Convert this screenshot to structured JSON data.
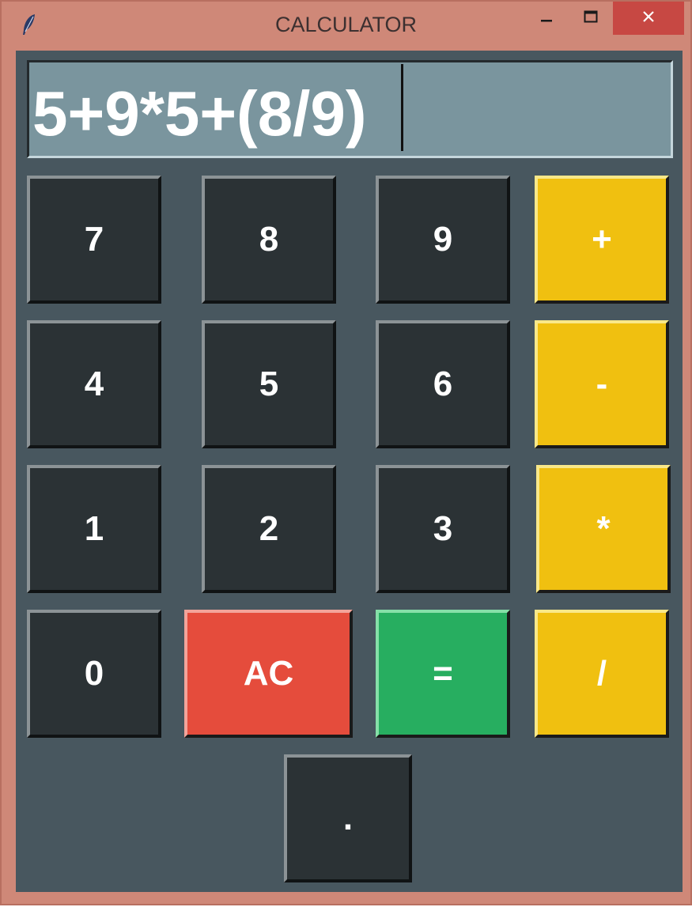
{
  "window": {
    "title": "CALCULATOR",
    "icon": "feather-icon",
    "controls": [
      "minimize-icon",
      "maximize-icon",
      "close-icon"
    ]
  },
  "display": {
    "expression": "5+9*5+(8/9)"
  },
  "keys": {
    "k7": "7",
    "k8": "8",
    "k9": "9",
    "plus": "+",
    "k4": "4",
    "k5": "5",
    "k6": "6",
    "minus": "-",
    "k1": "1",
    "k2": "2",
    "k3": "3",
    "multiply": "*",
    "k0": "0",
    "clear": "AC",
    "equals": "=",
    "divide": "/",
    "dot": "."
  },
  "colors": {
    "window_frame": "#cf8878",
    "background": "#48575f",
    "display": "#7a959e",
    "number_key": "#2b3235",
    "operator_key": "#f0c010",
    "clear_key": "#e54c3c",
    "equals_key": "#27ae60",
    "close_button": "#c74843"
  }
}
